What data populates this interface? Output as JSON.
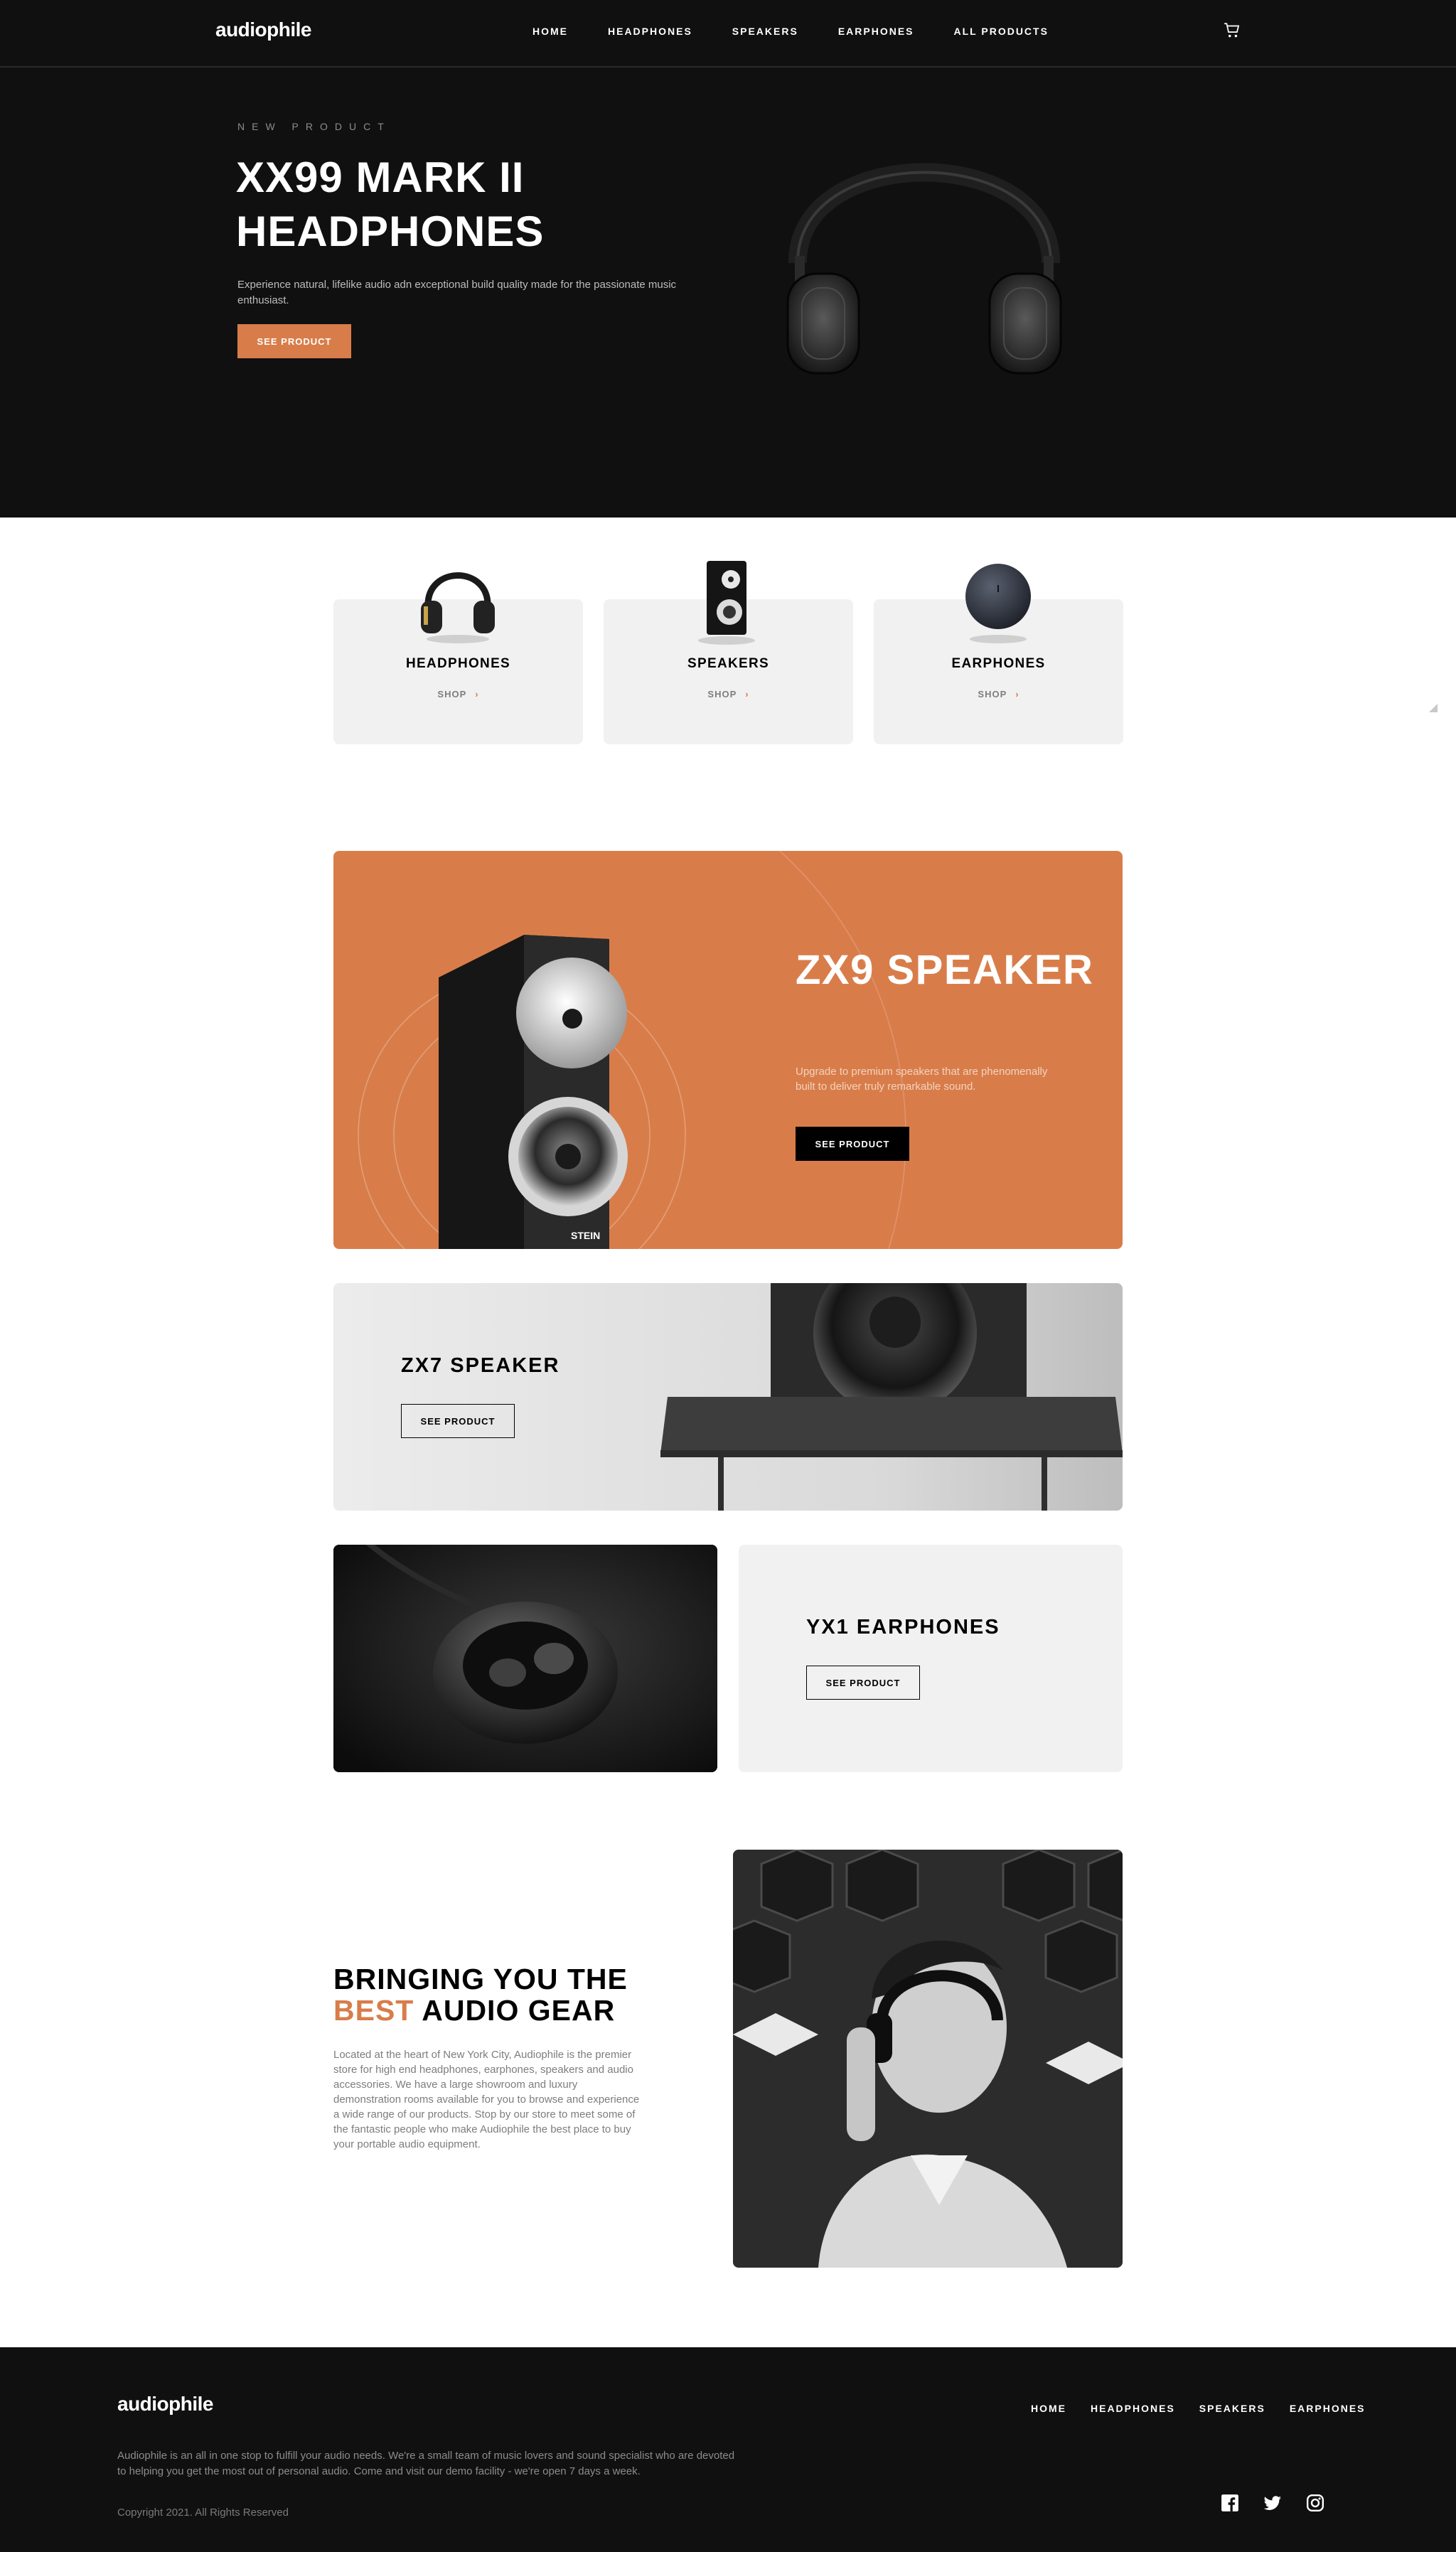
{
  "brand": {
    "logo": "audiophile",
    "accent_color": "#d87d4a",
    "dark_color": "#101010"
  },
  "nav": {
    "items": [
      "HOME",
      "HEADPHONES",
      "SPEAKERS",
      "EARPHONES",
      "ALL PRODUCTS"
    ],
    "cart_icon": "cart-icon"
  },
  "hero": {
    "overline": "NEW PRODUCT",
    "title": "XX99 MARK II HEADPHONES",
    "description": "Experience natural, lifelike audio adn exceptional build quality made for the passionate music enthusiast.",
    "button": "SEE PRODUCT"
  },
  "categories": [
    {
      "title": "HEADPHONES",
      "link": "SHOP"
    },
    {
      "title": "SPEAKERS",
      "link": "SHOP"
    },
    {
      "title": "EARPHONES",
      "link": "SHOP"
    }
  ],
  "zx9": {
    "title": "ZX9 SPEAKER",
    "description": "Upgrade to premium speakers that are phenomenally built to deliver truly remarkable sound.",
    "button": "SEE PRODUCT",
    "speaker_brand": "STEIN"
  },
  "zx7": {
    "title": "ZX7 SPEAKER",
    "button": "SEE PRODUCT"
  },
  "yx1": {
    "title": "YX1 EARPHONES",
    "button": "SEE PRODUCT"
  },
  "about": {
    "title_prefix": "BRINGING YOU THE",
    "title_accent": "BEST",
    "title_suffix": "AUDIO GEAR",
    "description": "Located at the heart of New York City, Audiophile is the premier store for high end headphones, earphones, speakers and audio accessories. We have a large showroom and luxury demonstration rooms available for you to browse and experience a wide range of our products. Stop by our store to meet some of the fantastic people who make Audiophile the best place to buy your portable audio equipment."
  },
  "footer": {
    "logo": "audiophile",
    "links": [
      "HOME",
      "HEADPHONES",
      "SPEAKERS",
      "EARPHONES"
    ],
    "description": "Audiophile is an all in one stop to fulfill your audio needs. We're a small team of music lovers and sound specialist who are devoted to helping you get the most out of personal audio. Come and visit our demo facility - we're open 7 days a week.",
    "copyright": "Copyright 2021. All Rights Reserved",
    "social_icons": [
      "facebook-icon",
      "twitter-icon",
      "instagram-icon"
    ]
  }
}
